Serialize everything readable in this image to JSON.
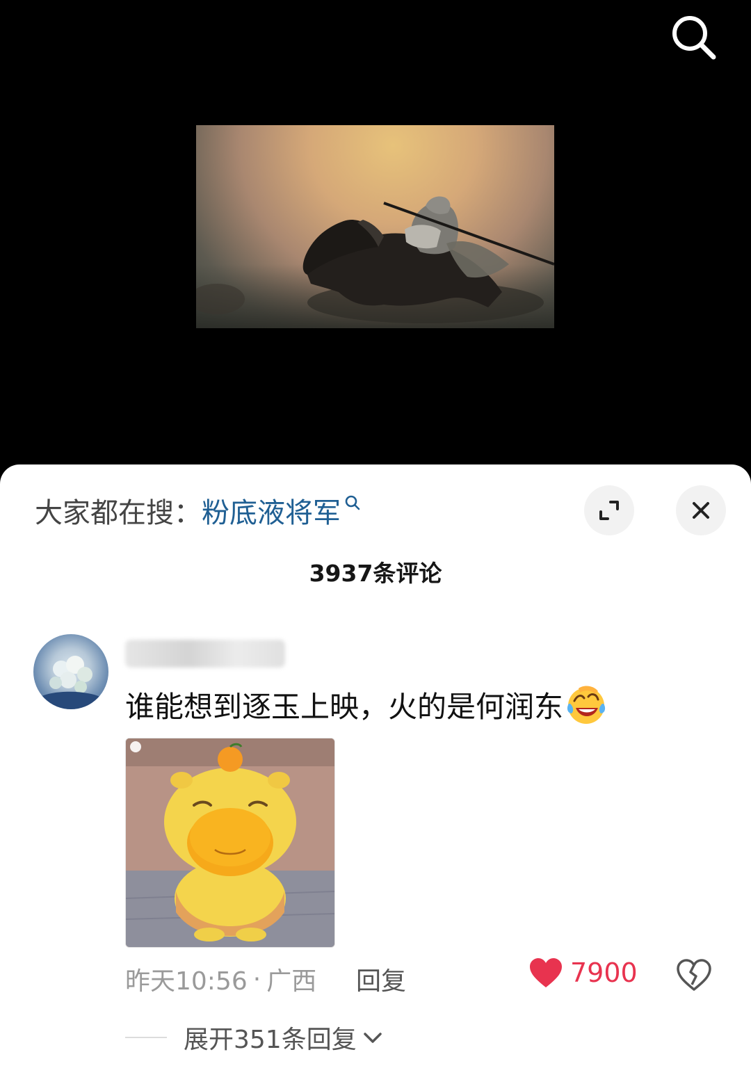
{
  "hot_search": {
    "prefix": "大家都在搜：",
    "keyword": "粉底液将军"
  },
  "comments": {
    "count_label": "3937条评论",
    "items": [
      {
        "text": "谁能想到逐玉上映，火的是何润东",
        "emoji": "laughing-crying-emoji",
        "time": "昨天10:56",
        "separator": "·",
        "location": "广西",
        "reply_label": "回复",
        "likes": "7900",
        "expand_label": "展开351条回复"
      }
    ]
  },
  "colors": {
    "keyword_blue": "#1f5f93",
    "like_red": "#e8334f"
  }
}
